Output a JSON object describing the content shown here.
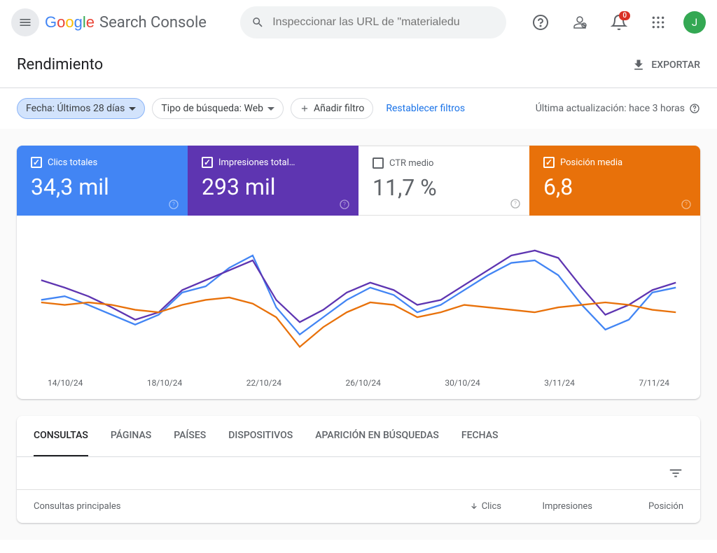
{
  "header": {
    "logo_g": "Google",
    "logo_sc": "Search Console",
    "search_placeholder": "Inspeccionar las URL de \"materialedu",
    "notification_count": "0",
    "avatar_letter": "J"
  },
  "page": {
    "title": "Rendimiento",
    "export_label": "EXPORTAR"
  },
  "filters": {
    "date_chip": "Fecha: Últimos 28 días",
    "search_type_chip": "Tipo de búsqueda: Web",
    "add_filter": "Añadir filtro",
    "reset": "Restablecer filtros",
    "last_update": "Última actualización: hace 3 horas"
  },
  "metrics": {
    "clicks": {
      "label": "Clics totales",
      "value": "34,3 mil"
    },
    "impressions": {
      "label": "Impresiones total…",
      "value": "293 mil"
    },
    "ctr": {
      "label": "CTR medio",
      "value": "11,7 %"
    },
    "position": {
      "label": "Posición media",
      "value": "6,8"
    }
  },
  "chart_data": {
    "type": "line",
    "x_labels": [
      "14/10/24",
      "18/10/24",
      "22/10/24",
      "26/10/24",
      "30/10/24",
      "3/11/24",
      "7/11/24"
    ],
    "series": [
      {
        "name": "Clics totales",
        "color": "#4285f4",
        "values": [
          52,
          55,
          48,
          40,
          32,
          40,
          58,
          63,
          78,
          88,
          46,
          24,
          38,
          52,
          62,
          56,
          42,
          48,
          60,
          72,
          82,
          84,
          72,
          48,
          28,
          36,
          58,
          62
        ]
      },
      {
        "name": "Impresiones totales",
        "color": "#5e35b1",
        "values": [
          68,
          62,
          55,
          46,
          36,
          42,
          60,
          68,
          76,
          84,
          52,
          34,
          44,
          58,
          66,
          60,
          48,
          52,
          64,
          76,
          88,
          92,
          86,
          62,
          40,
          48,
          60,
          66
        ]
      },
      {
        "name": "Posición media",
        "color": "#e8710a",
        "values": [
          50,
          48,
          50,
          48,
          44,
          42,
          48,
          52,
          54,
          49,
          38,
          14,
          30,
          42,
          50,
          48,
          38,
          42,
          48,
          46,
          44,
          42,
          46,
          48,
          50,
          48,
          44,
          42
        ]
      }
    ]
  },
  "tabs": [
    "CONSULTAS",
    "PÁGINAS",
    "PAÍSES",
    "DISPOSITIVOS",
    "APARICIÓN EN BÚSQUEDAS",
    "FECHAS"
  ],
  "table": {
    "main_header": "Consultas principales",
    "col_clicks": "Clics",
    "col_impressions": "Impresiones",
    "col_position": "Posición"
  }
}
